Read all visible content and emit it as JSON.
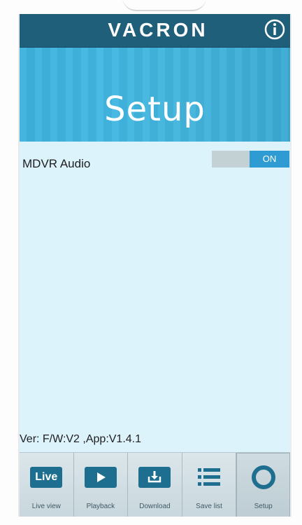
{
  "brand": {
    "logo_text": "VACRON",
    "info_icon": "info-icon"
  },
  "hero": {
    "title": "Setup"
  },
  "settings": [
    {
      "label": "MDVR Audio",
      "toggle": {
        "state_label": "ON",
        "on": true
      }
    }
  ],
  "footer": {
    "version_text": "Ver: F/W:V2 ,App:V1.4.1"
  },
  "tabs": [
    {
      "label": "Live view",
      "icon": "live-icon",
      "icon_text": "Live",
      "active": false
    },
    {
      "label": "Playback",
      "icon": "play-icon",
      "active": false
    },
    {
      "label": "Download",
      "icon": "download-icon",
      "active": false
    },
    {
      "label": "Save list",
      "icon": "list-icon",
      "active": false
    },
    {
      "label": "Setup",
      "icon": "circle-icon",
      "active": true
    }
  ],
  "colors": {
    "brand_bar": "#1f5f7a",
    "hero": "#41b7e2",
    "content_bg": "#ddf3fc",
    "toggle_on": "#2e9bd2",
    "tab_icon": "#1e6f8f"
  }
}
